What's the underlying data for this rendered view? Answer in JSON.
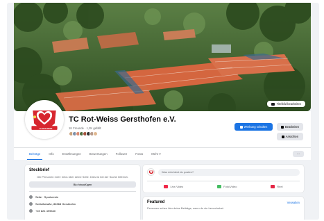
{
  "cover": {
    "edit_label": "Titelbild bearbeiten"
  },
  "page": {
    "name": "TC Rot-Weiss Gersthofen e.V.",
    "subtitle": "1K Freunde · 1,2K gefällt",
    "logo_text": "TC ROT-WEISS"
  },
  "actions": {
    "primary_label": "Werbung schalten",
    "secondary_1_label": "Bearbeiten",
    "secondary_2_label": "Ansichten"
  },
  "tabs": [
    {
      "label": "Beiträge"
    },
    {
      "label": "Info"
    },
    {
      "label": "Erwähnungen"
    },
    {
      "label": "Bewertungen"
    },
    {
      "label": "Follower"
    },
    {
      "label": "Fotos"
    },
    {
      "label": "Mehr ▾"
    }
  ],
  "tabs_more_button": "···",
  "intro": {
    "title": "Steckbrief",
    "text": "Gib Personen mehr Infos über deine Seite. Dies ist bei der Suche hilfreich.",
    "button_label": "Bio hinzufügen",
    "rows": [
      {
        "text": "Seite · Sportverein"
      },
      {
        "text": "Schloßstraße, 86368 Gersthofen"
      },
      {
        "text": "+49 821 499540"
      }
    ]
  },
  "composer": {
    "placeholder": "Was möchtest du posten?",
    "actions": [
      {
        "label": "Live-Video",
        "color": "#f02849"
      },
      {
        "label": "Foto/Video",
        "color": "#45bd62"
      },
      {
        "label": "Reel",
        "color": "#e42645"
      }
    ]
  },
  "featured": {
    "title": "Featured",
    "link": "Verwalten",
    "text": "Personen sehen hier deine Beiträge, wenn du sie hervorhebst."
  },
  "colors": {
    "accent": "#1b74e4",
    "brand_red": "#d7262f"
  }
}
